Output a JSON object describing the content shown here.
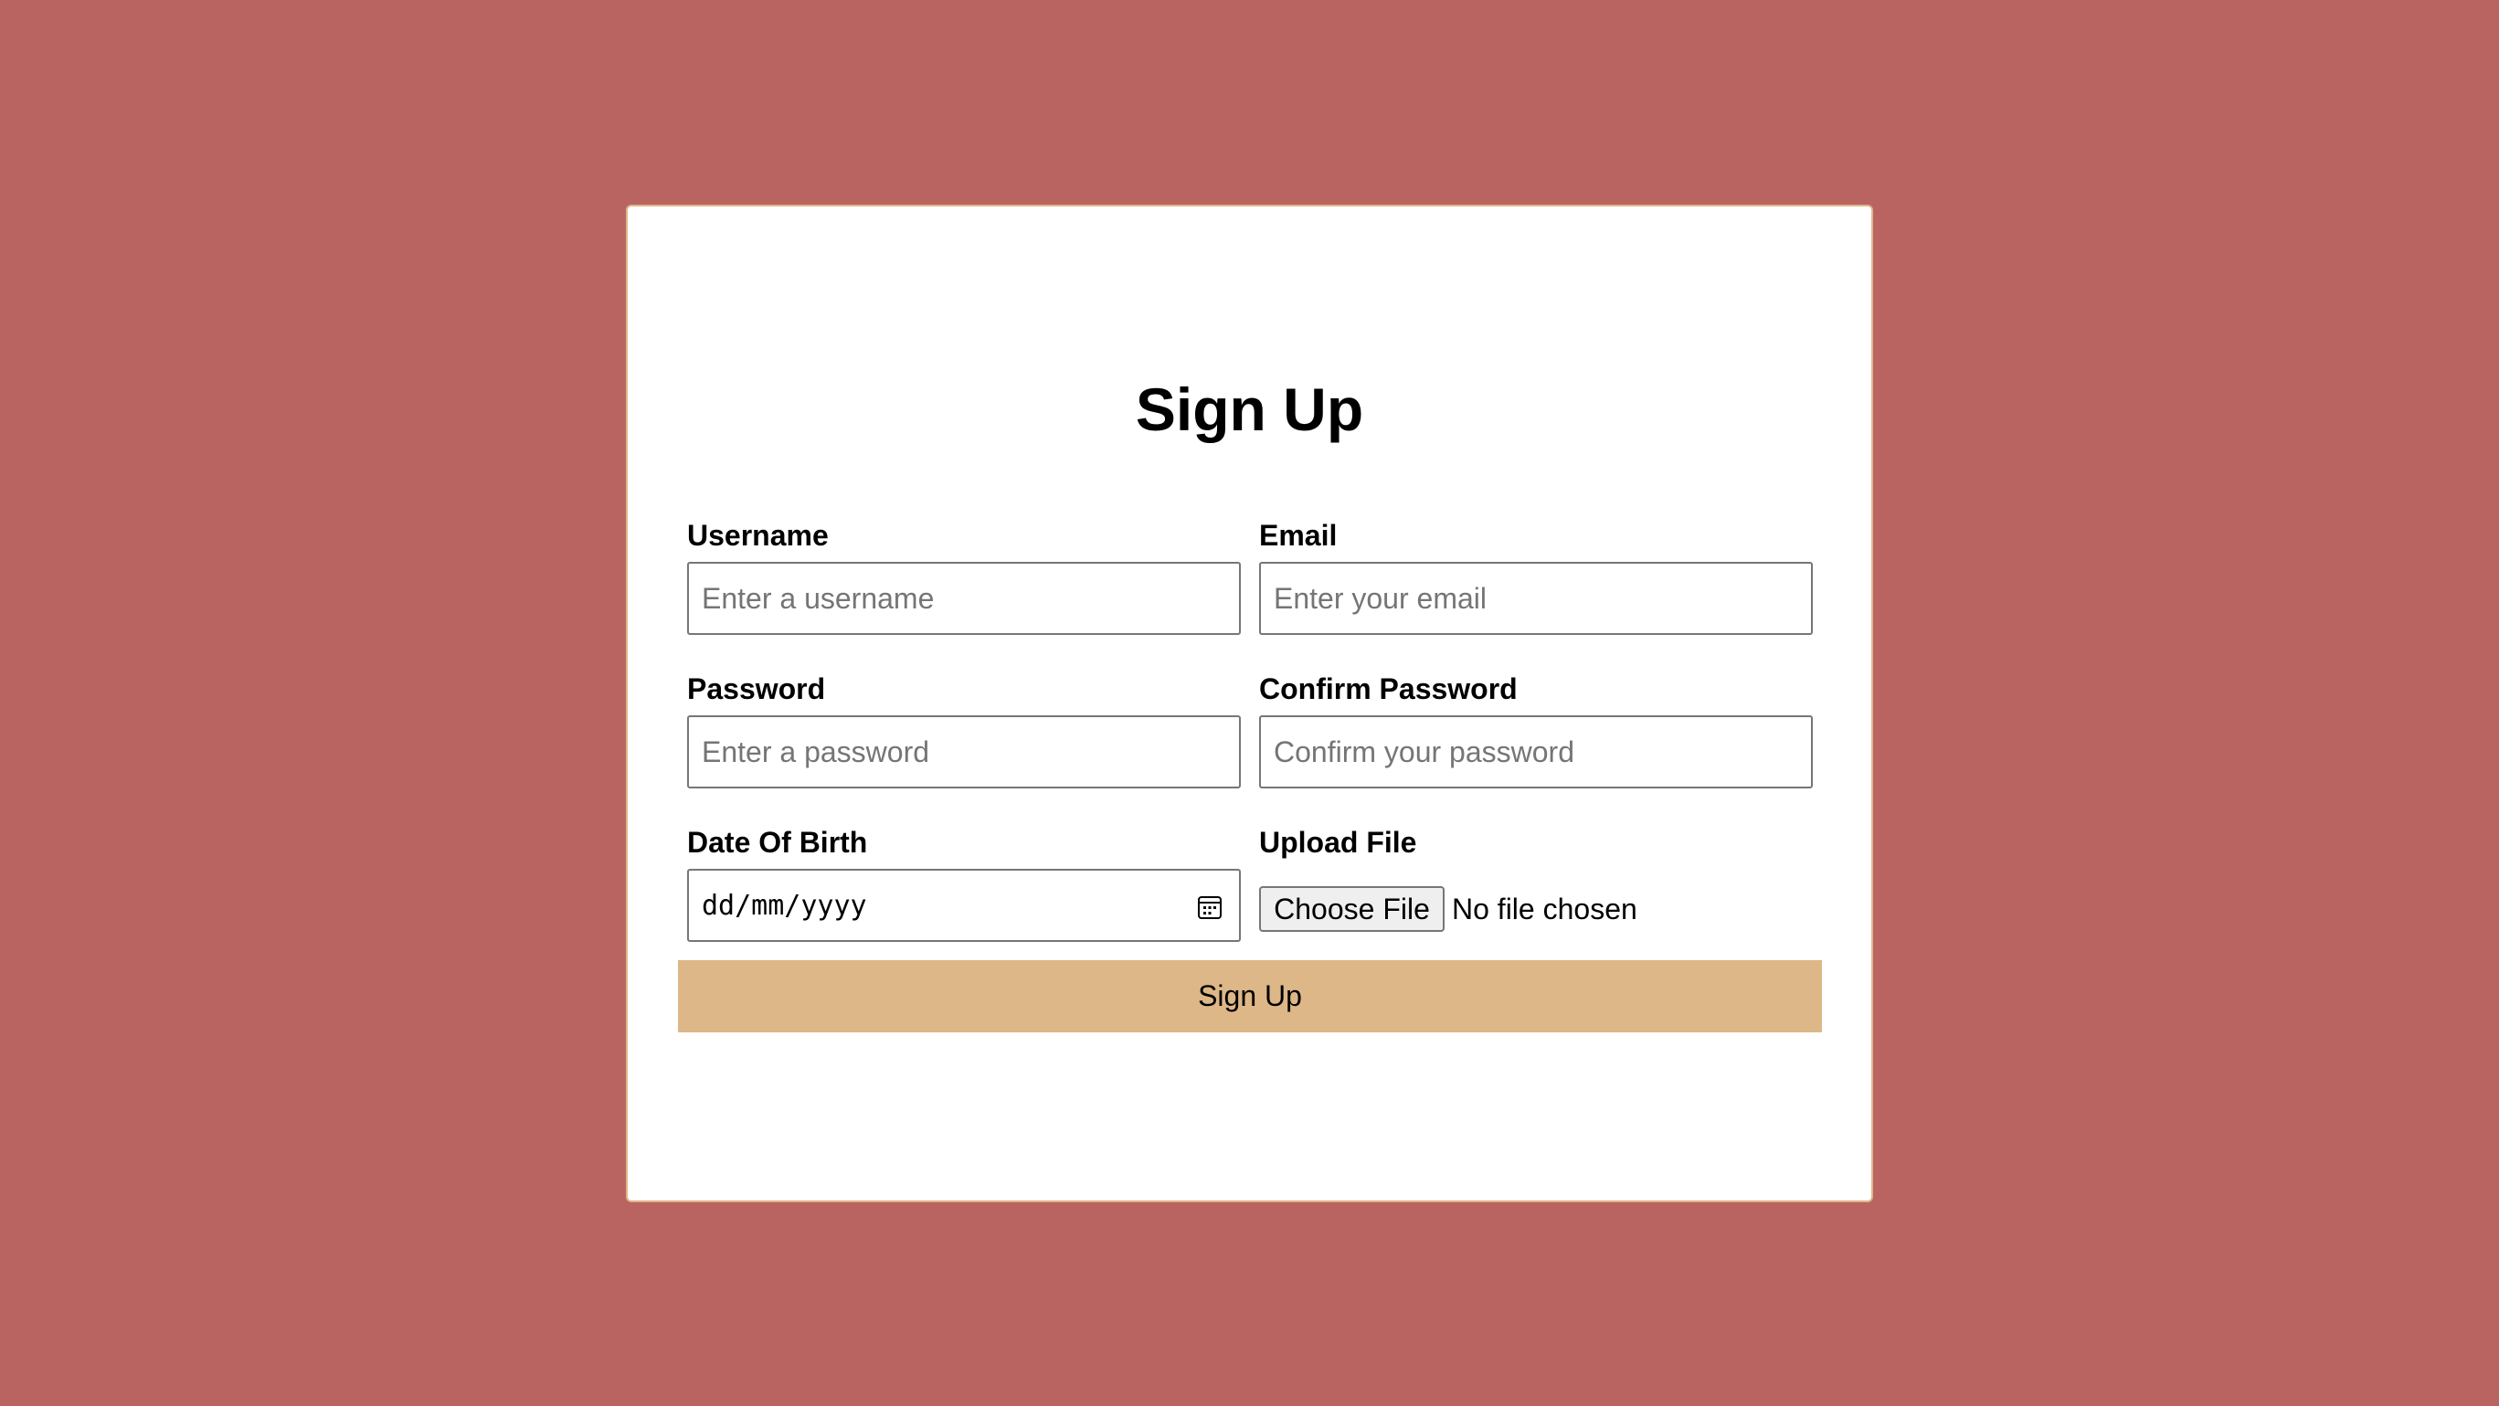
{
  "page": {
    "background_color": "#ba6462",
    "card_background_color": "#ffffff",
    "card_border_color": "#dfb788",
    "accent_color": "#ddb787"
  },
  "form": {
    "title": "Sign Up",
    "fields": {
      "username": {
        "label": "Username",
        "placeholder": "Enter a username",
        "value": ""
      },
      "email": {
        "label": "Email",
        "placeholder": "Enter your email",
        "value": ""
      },
      "password": {
        "label": "Password",
        "placeholder": "Enter a password",
        "value": ""
      },
      "confirm_password": {
        "label": "Confirm Password",
        "placeholder": "Confirm your password",
        "value": ""
      },
      "date_of_birth": {
        "label": "Date Of Birth",
        "placeholder": "dd/mm/yyyy",
        "icon": "calendar-icon"
      },
      "upload_file": {
        "label": "Upload File",
        "button_label": "Choose File",
        "status": "No file chosen"
      }
    },
    "submit_label": "Sign Up"
  }
}
